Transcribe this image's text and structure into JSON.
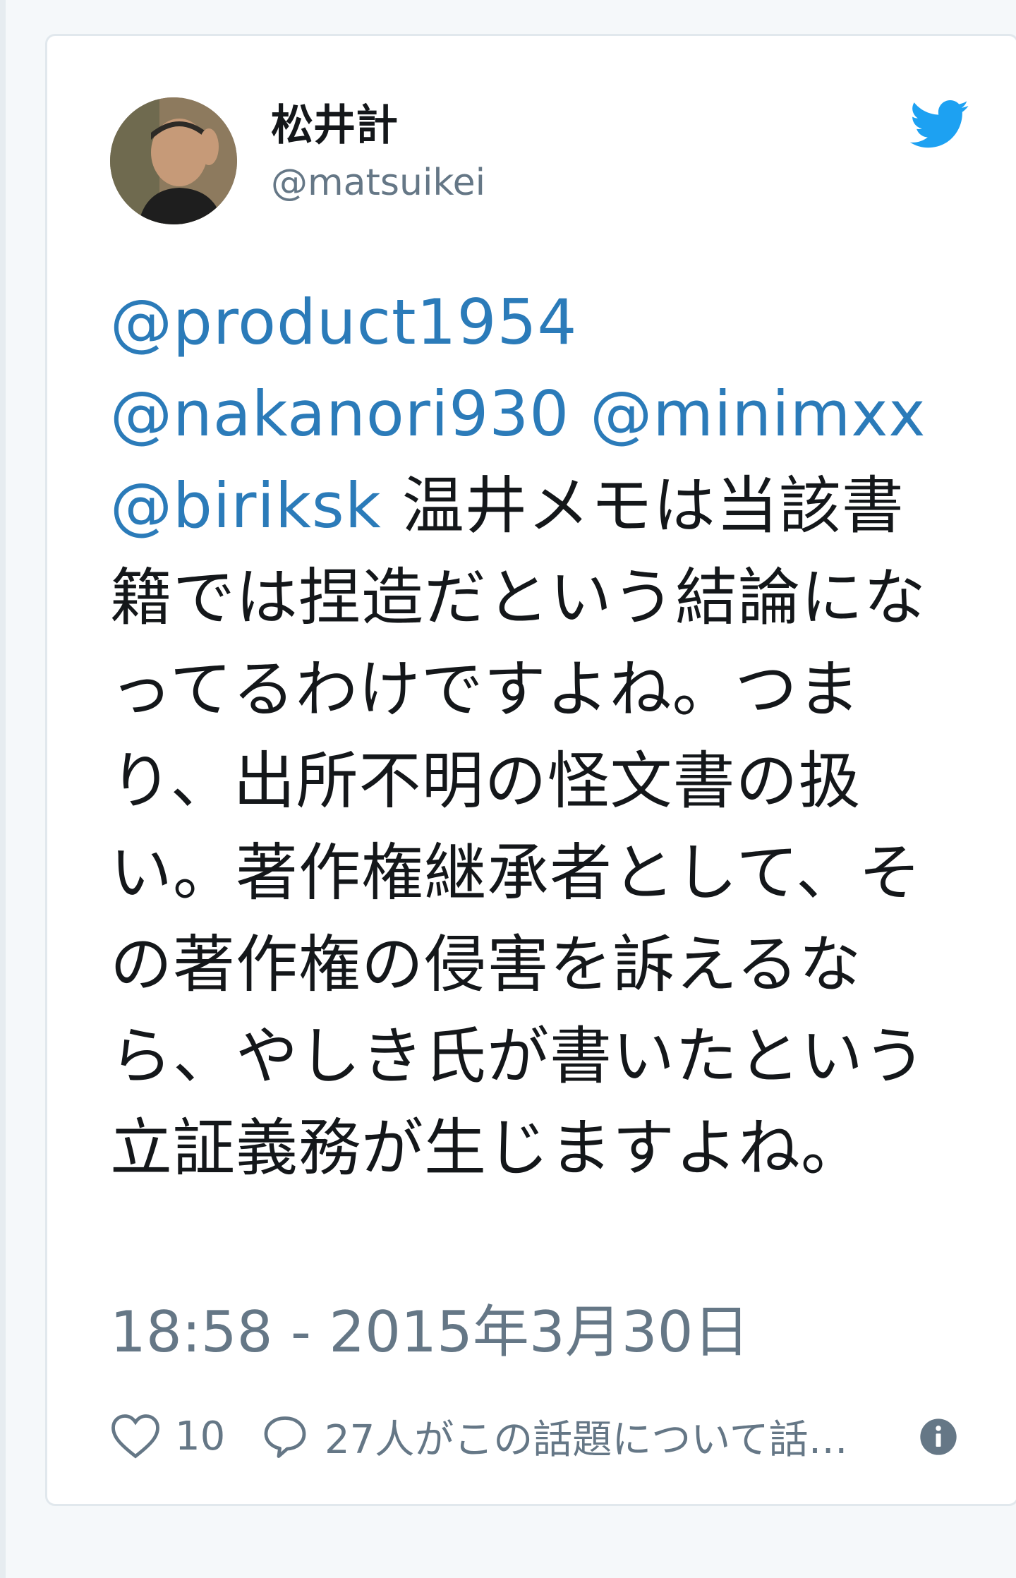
{
  "author": {
    "display_name": "松井計",
    "handle": "@matsuikei"
  },
  "tweet": {
    "mentions": [
      "@product1954",
      "@nakanori930",
      "@minimxx",
      "@biriksk"
    ],
    "text": "温井メモは当該書籍では捏造だという結論になってるわけですよね。つまり、出所不明の怪文書の扱い。著作権継承者として、その著作権の侵害を訴えるなら、やしき氏が書いたという立証義務が生じますよね。",
    "timestamp": "18:58 - 2015年3月30日"
  },
  "actions": {
    "like_count": "10",
    "reply_text": "27人がこの話題について話…"
  },
  "icons": {
    "brand": "twitter-bird-icon",
    "like": "heart-icon",
    "reply": "speech-bubble-icon",
    "info": "info-icon"
  },
  "colors": {
    "mention": "#2b7bb9",
    "twitter_blue": "#1da1f2",
    "muted": "#657786",
    "text": "#14171a"
  }
}
